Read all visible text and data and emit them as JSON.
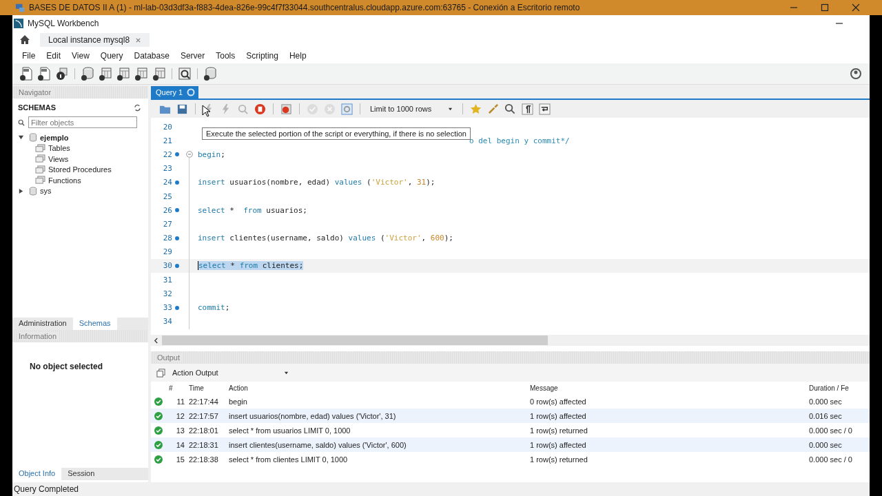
{
  "remote_window": {
    "title": "BASES DE DATOS II A (1) - ml-lab-03d3df3a-f883-4dea-826e-99c4f7f33044.southcentralus.cloudapp.azure.com:63765 - Conexión a Escritorio remoto"
  },
  "app_title": "MySQL Workbench",
  "connection_tabs": [
    {
      "label": "Local instance mysql8",
      "selected": true
    }
  ],
  "menu": [
    "File",
    "Edit",
    "View",
    "Query",
    "Database",
    "Server",
    "Tools",
    "Scripting",
    "Help"
  ],
  "main_toolbar": [
    {
      "kind": "sql-new"
    },
    {
      "kind": "sql-open"
    },
    {
      "kind": "info"
    },
    {
      "kind": "sep"
    },
    {
      "kind": "schema"
    },
    {
      "kind": "table"
    },
    {
      "kind": "view"
    },
    {
      "kind": "routine"
    },
    {
      "kind": "function"
    },
    {
      "kind": "sep"
    },
    {
      "kind": "inspect"
    },
    {
      "kind": "sep"
    },
    {
      "kind": "reconnect"
    }
  ],
  "navigator": {
    "title": "Navigator",
    "schemas_title": "SCHEMAS",
    "filter_placeholder": "Filter objects",
    "tree": [
      {
        "label": "ejemplo",
        "expanded": true,
        "bold": true,
        "children": [
          {
            "label": "Tables"
          },
          {
            "label": "Views"
          },
          {
            "label": "Stored Procedures"
          },
          {
            "label": "Functions"
          }
        ]
      },
      {
        "label": "sys",
        "expanded": false,
        "bold": false
      }
    ],
    "tabs": [
      {
        "label": "Administration",
        "selected": false
      },
      {
        "label": "Schemas",
        "selected": true
      }
    ]
  },
  "information": {
    "title": "Information",
    "message": "No object selected",
    "tabs": [
      {
        "label": "Object Info",
        "selected": true
      },
      {
        "label": "Session",
        "selected": false
      }
    ]
  },
  "query_tabs": [
    {
      "label": "Query 1",
      "selected": true
    }
  ],
  "editor_toolbar": [
    {
      "kind": "open",
      "disabled": false
    },
    {
      "kind": "save",
      "disabled": false
    },
    {
      "kind": "sep"
    },
    {
      "kind": "execute",
      "disabled": true
    },
    {
      "kind": "execute-line",
      "disabled": true
    },
    {
      "kind": "explain",
      "disabled": true
    },
    {
      "kind": "stop",
      "disabled": false
    },
    {
      "kind": "sep"
    },
    {
      "kind": "error-toggle",
      "disabled": false
    },
    {
      "kind": "sep"
    },
    {
      "kind": "commit",
      "disabled": true
    },
    {
      "kind": "rollback",
      "disabled": true
    },
    {
      "kind": "autocommit",
      "disabled": false
    },
    {
      "kind": "sep"
    },
    {
      "kind": "limit",
      "label": "Limit to 1000 rows"
    },
    {
      "kind": "sep"
    },
    {
      "kind": "beautify",
      "disabled": false
    },
    {
      "kind": "brush",
      "disabled": false
    },
    {
      "kind": "find",
      "disabled": false
    },
    {
      "kind": "invisible",
      "disabled": false
    },
    {
      "kind": "wrap",
      "disabled": false
    }
  ],
  "tooltip": "Execute the selected portion of the script or everything, if there is no selection",
  "code_lines": [
    {
      "num": "20",
      "fold": false,
      "selected": false
    },
    {
      "num": "21",
      "fold": false,
      "selected": false,
      "tokens": [
        {
          "kind": "comment_tail",
          "text": "o del begin y commit*/"
        }
      ]
    },
    {
      "num": "22",
      "fold": true,
      "selected": false,
      "tokens": [
        {
          "kind": "keyword",
          "text": "begin"
        },
        {
          "kind": "plain",
          "text": ";"
        }
      ]
    },
    {
      "num": "23",
      "fold": false,
      "selected": false
    },
    {
      "num": "24",
      "fold": false,
      "selected": false,
      "tokens": [
        {
          "kind": "keyword",
          "text": "insert"
        },
        {
          "kind": "plain",
          "text": " usuarios(nombre, edad) "
        },
        {
          "kind": "keyword",
          "text": "values"
        },
        {
          "kind": "plain",
          "text": " ("
        },
        {
          "kind": "string",
          "text": "'Victor'"
        },
        {
          "kind": "plain",
          "text": ", "
        },
        {
          "kind": "number",
          "text": "31"
        },
        {
          "kind": "plain",
          "text": ");"
        }
      ]
    },
    {
      "num": "25",
      "fold": false,
      "selected": false
    },
    {
      "num": "26",
      "fold": false,
      "selected": false,
      "tokens": [
        {
          "kind": "keyword",
          "text": "select"
        },
        {
          "kind": "plain",
          "text": " *  "
        },
        {
          "kind": "keyword",
          "text": "from"
        },
        {
          "kind": "plain",
          "text": " usuarios;"
        }
      ]
    },
    {
      "num": "27",
      "fold": false,
      "selected": false
    },
    {
      "num": "28",
      "fold": false,
      "selected": false,
      "tokens": [
        {
          "kind": "keyword",
          "text": "insert"
        },
        {
          "kind": "plain",
          "text": " clientes(username, saldo) "
        },
        {
          "kind": "keyword",
          "text": "values"
        },
        {
          "kind": "plain",
          "text": " ("
        },
        {
          "kind": "string",
          "text": "'Victor'"
        },
        {
          "kind": "plain",
          "text": ", "
        },
        {
          "kind": "number",
          "text": "600"
        },
        {
          "kind": "plain",
          "text": ");"
        }
      ]
    },
    {
      "num": "29",
      "fold": false,
      "selected": false
    },
    {
      "num": "30",
      "fold": false,
      "selected": true,
      "tokens": [
        {
          "kind": "keyword",
          "text": "select"
        },
        {
          "kind": "plain",
          "text": " * "
        },
        {
          "kind": "keyword",
          "text": "from"
        },
        {
          "kind": "plain",
          "text": " clientes;"
        }
      ]
    },
    {
      "num": "31",
      "fold": false,
      "selected": false
    },
    {
      "num": "32",
      "fold": false,
      "selected": false
    },
    {
      "num": "33",
      "fold": false,
      "selected": false,
      "tokens": [
        {
          "kind": "keyword",
          "text": "commit"
        },
        {
          "kind": "plain",
          "text": ";"
        }
      ]
    },
    {
      "num": "34",
      "fold": false,
      "selected": false
    }
  ],
  "output": {
    "title": "Output",
    "mode": "Action Output",
    "columns": [
      "#",
      "Time",
      "Action",
      "Message",
      "Duration / Fe"
    ],
    "rows": [
      {
        "success": true,
        "num": "11",
        "time": "22:17:44",
        "action": "begin",
        "message": "0 row(s) affected",
        "duration": "0.000 sec"
      },
      {
        "success": true,
        "num": "12",
        "time": "22:17:57",
        "action": "insert usuarios(nombre, edad) values ('Victor', 31)",
        "message": "1 row(s) affected",
        "duration": "0.016 sec"
      },
      {
        "success": true,
        "num": "13",
        "time": "22:18:01",
        "action": "select * from usuarios LIMIT 0, 1000",
        "message": "1 row(s) returned",
        "duration": "0.000 sec / 0"
      },
      {
        "success": true,
        "num": "14",
        "time": "22:18:31",
        "action": "insert clientes(username, saldo) values ('Victor', 600)",
        "message": "1 row(s) affected",
        "duration": "0.000 sec"
      },
      {
        "success": true,
        "num": "15",
        "time": "22:18:38",
        "action": "select * from clientes LIMIT 0, 1000",
        "message": "1 row(s) returned",
        "duration": "0.000 sec / 0"
      }
    ]
  },
  "status_bar": "Query Completed"
}
